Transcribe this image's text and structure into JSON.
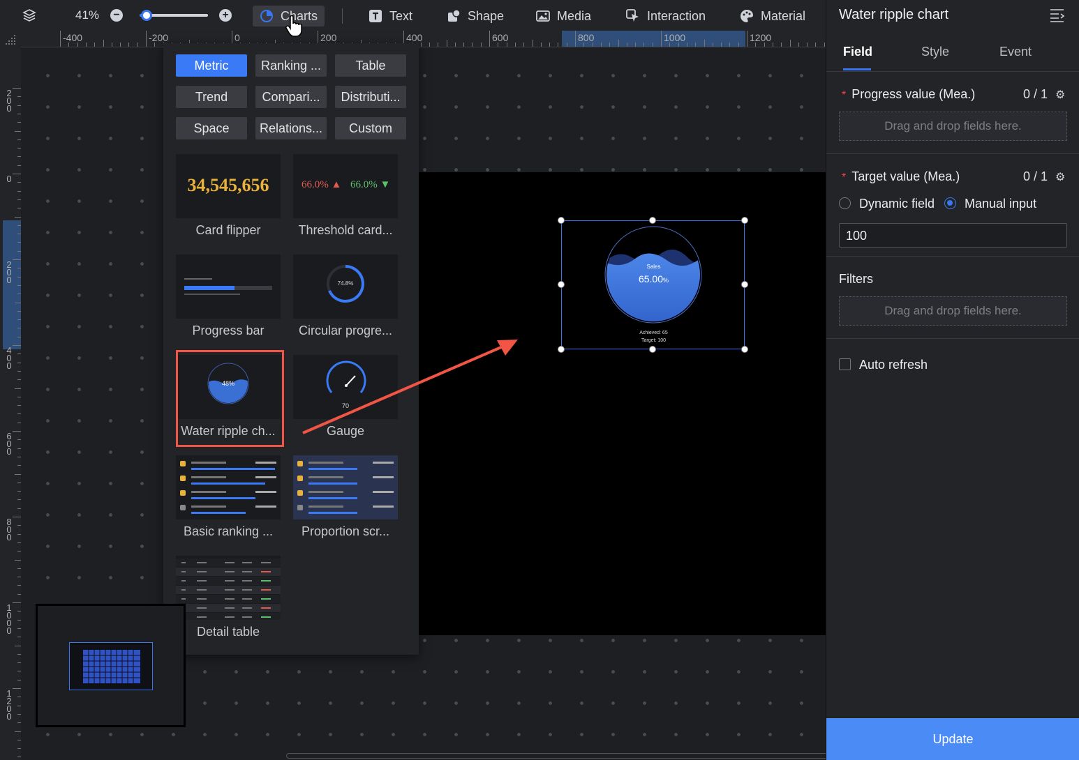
{
  "toolbar": {
    "zoom": "41%",
    "zoom_level": 0.1,
    "items": [
      {
        "label": "Charts",
        "icon": "pie-chart-icon"
      },
      {
        "label": "Text",
        "icon": "text-icon"
      },
      {
        "label": "Shape",
        "icon": "shape-icon"
      },
      {
        "label": "Media",
        "icon": "image-icon"
      },
      {
        "label": "Interaction",
        "icon": "cursor-icon"
      },
      {
        "label": "Material",
        "icon": "palette-icon"
      }
    ]
  },
  "ruler": {
    "top_labels": [
      "-400",
      "-200",
      "0",
      "200",
      "400",
      "600",
      "800",
      "1000",
      "1200"
    ],
    "left_labels": [
      "200",
      "0",
      "200",
      "400",
      "600",
      "800",
      "1000",
      "1200"
    ]
  },
  "chart_panel": {
    "categories": [
      {
        "label": "Metric",
        "active": true
      },
      {
        "label": "Ranking ...",
        "active": false
      },
      {
        "label": "Table",
        "active": false
      },
      {
        "label": "Trend",
        "active": false
      },
      {
        "label": "Compari...",
        "active": false
      },
      {
        "label": "Distributi...",
        "active": false
      },
      {
        "label": "Space",
        "active": false
      },
      {
        "label": "Relations...",
        "active": false
      },
      {
        "label": "Custom",
        "active": false
      }
    ],
    "charts": [
      {
        "label": "Card flipper"
      },
      {
        "label": "Threshold card..."
      },
      {
        "label": "Progress bar"
      },
      {
        "label": "Circular progre..."
      },
      {
        "label": "Water ripple ch...",
        "highlighted": true
      },
      {
        "label": "Gauge"
      },
      {
        "label": "Basic ranking ..."
      },
      {
        "label": "Proportion scr..."
      },
      {
        "label": "Detail table"
      }
    ],
    "card_flipper_value": "34,545,656",
    "threshold_values": [
      "66.0%",
      "66.0%"
    ],
    "circular_value": "74.8%",
    "water_ripple_value": "48%",
    "gauge_value": "70"
  },
  "widget": {
    "metric_label": "Sales",
    "value": "65.00",
    "unit": "%",
    "achieved": "Achieved: 65",
    "target": "Target: 100"
  },
  "right_panel": {
    "title": "Water ripple chart",
    "tabs": [
      {
        "label": "Field",
        "active": true
      },
      {
        "label": "Style",
        "active": false
      },
      {
        "label": "Event",
        "active": false
      }
    ],
    "progress_value": {
      "label": "Progress value (Mea.)",
      "count": "0 / 1"
    },
    "dropzone_text": "Drag and drop fields here.",
    "target_value": {
      "label": "Target value (Mea.)",
      "count": "0 / 1"
    },
    "radio_dynamic": "Dynamic field",
    "radio_manual": "Manual input",
    "target_input": "100",
    "filters_label": "Filters",
    "filters_dropzone": "Drag and drop fields here.",
    "auto_refresh": "Auto refresh",
    "update_button": "Update"
  },
  "colors": {
    "accent": "#3a76f0",
    "arrow": "#f05545",
    "highlight": "#f05545"
  }
}
